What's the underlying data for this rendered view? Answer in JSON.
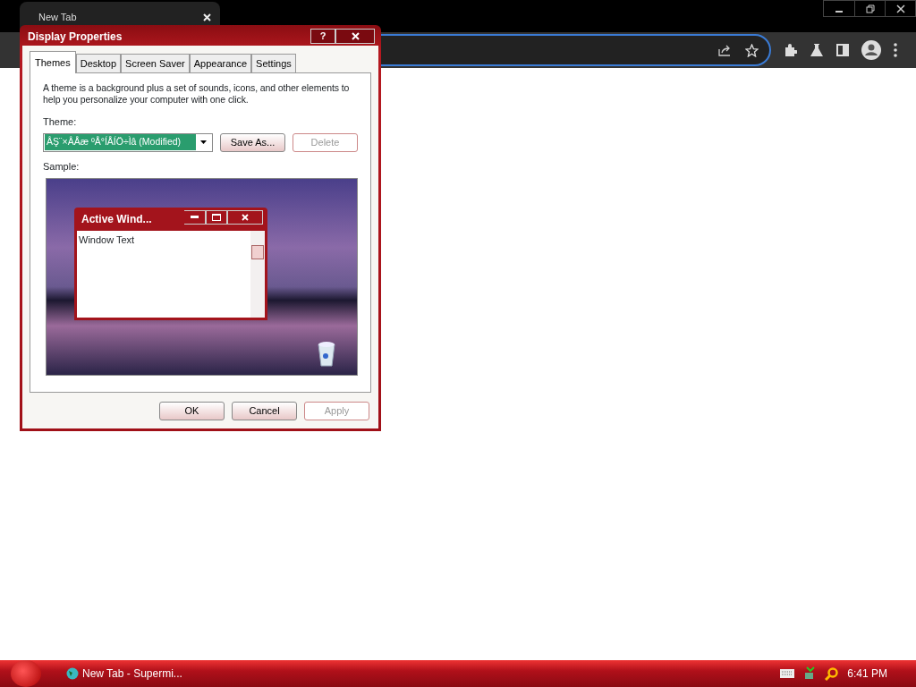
{
  "browser": {
    "tab_title": "New Tab"
  },
  "dialog": {
    "title": "Display Properties",
    "help_glyph": "?",
    "tabs": [
      {
        "label": "Themes",
        "selected": true
      },
      {
        "label": "Desktop",
        "selected": false
      },
      {
        "label": "Screen Saver",
        "selected": false
      },
      {
        "label": "Appearance",
        "selected": false
      },
      {
        "label": "Settings",
        "selected": false
      }
    ],
    "description": "A theme is a background plus a set of sounds, icons, and other elements to help you personalize your computer with one click.",
    "theme_label": "Theme:",
    "theme_value": "ÂŞ¨×ÂÅæ ºÅ°ÍÅÍÖ÷Ìâ (Modified)",
    "theme_buttons": [
      {
        "label": "Save As...",
        "disabled": false
      },
      {
        "label": "Delete",
        "disabled": true
      }
    ],
    "sample_label": "Sample:",
    "sample": {
      "window_title": "Active Wind...",
      "window_text": "Window Text"
    },
    "buttons": [
      {
        "label": "OK",
        "disabled": false
      },
      {
        "label": "Cancel",
        "disabled": false
      },
      {
        "label": "Apply",
        "disabled": true
      }
    ]
  },
  "taskbar": {
    "task": "New Tab - Supermi...",
    "clock": "6:41 PM"
  }
}
